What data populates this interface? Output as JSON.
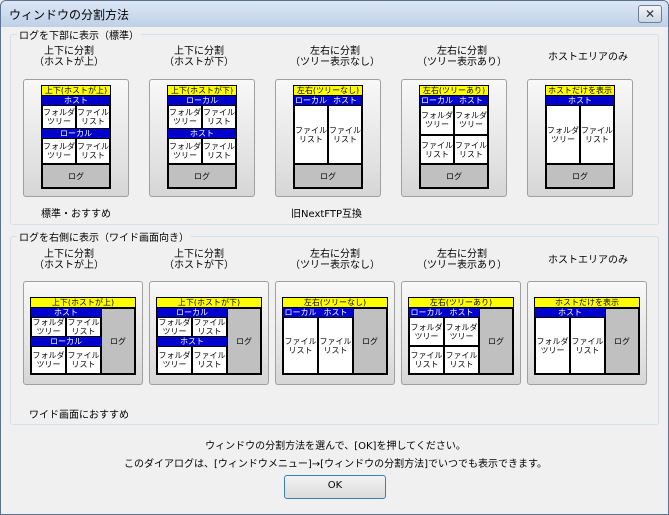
{
  "window": {
    "title": "ウィンドウの分割方法",
    "close": "✕"
  },
  "group_bottom": {
    "title": "ログを下部に表示（標準）",
    "options": [
      {
        "label": "上下に分割\n（ホストが上）",
        "header": "上下(ホストが上)",
        "top": "ホスト",
        "middle": "ローカル",
        "left": "フォルダ\nツリー",
        "right": "ファイル\nリスト",
        "log": "ログ"
      },
      {
        "label": "上下に分割\n（ホストが下）",
        "header": "上下(ホストが下)",
        "top": "ローカル",
        "middle": "ホスト",
        "left": "フォルダ\nツリー",
        "right": "ファイル\nリスト",
        "log": "ログ"
      },
      {
        "label": "左右に分割\n（ツリー表示なし）",
        "header": "左右(ツリーなし)",
        "left_head": "ローカル",
        "right_head": "ホスト",
        "left": "ファイル\nリスト",
        "right": "ファイル\nリスト",
        "log": "ログ"
      },
      {
        "label": "左右に分割\n（ツリー表示あり）",
        "header": "左右(ツリーあり)",
        "left_head": "ローカル",
        "right_head": "ホスト",
        "tl": "フォルダ\nツリー",
        "tr": "フォルダ\nツリー",
        "bl": "ファイル\nリスト",
        "br": "ファイル\nリスト",
        "log": "ログ"
      },
      {
        "label": "ホストエリアのみ",
        "header": "ホストだけを表示",
        "top": "ホスト",
        "left": "フォルダ\nツリー",
        "right": "ファイル\nリスト",
        "log": "ログ"
      }
    ],
    "note1": "標準・おすすめ",
    "note2": "旧NextFTP互換"
  },
  "group_right": {
    "title": "ログを右側に表示（ワイド画面向き）",
    "options": [
      {
        "label": "上下に分割\n（ホストが上）",
        "header": "上下(ホストが上)",
        "top": "ホスト",
        "middle": "ローカル",
        "left": "フォルダ\nツリー",
        "right": "ファイル\nリスト",
        "log": "ログ"
      },
      {
        "label": "上下に分割\n（ホストが下）",
        "header": "上下(ホストが下)",
        "top": "ローカル",
        "middle": "ホスト",
        "left": "フォルダ\nツリー",
        "right": "ファイル\nリスト",
        "log": "ログ"
      },
      {
        "label": "左右に分割\n（ツリー表示なし）",
        "header": "左右(ツリーなし)",
        "left_head": "ローカル",
        "right_head": "ホスト",
        "left": "ファイル\nリスト",
        "right": "ファイル\nリスト",
        "log": "ログ"
      },
      {
        "label": "左右に分割\n（ツリー表示あり）",
        "header": "左右(ツリーあり)",
        "left_head": "ローカル",
        "right_head": "ホスト",
        "tl": "フォルダ\nツリー",
        "tr": "フォルダ\nツリー",
        "bl": "ファイル\nリスト",
        "br": "ファイル\nリスト",
        "log": "ログ"
      },
      {
        "label": "ホストエリアのみ",
        "header": "ホストだけを表示",
        "top": "ホスト",
        "left": "フォルダ\nツリー",
        "right": "ファイル\nリスト",
        "log": "ログ"
      }
    ],
    "note1": "ワイド画面におすすめ"
  },
  "message1": "ウィンドウの分割方法を選んで、[OK]を押してください。",
  "message2": "このダイアログは、[ウィンドウメニュー]→[ウィンドウの分割方法]でいつでも表示できます。",
  "ok": "OK"
}
